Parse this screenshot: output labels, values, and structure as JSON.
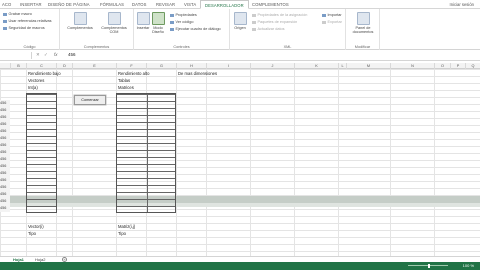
{
  "ribbon_tabs": [
    "ACO",
    "INSERTAR",
    "DISEÑO DE PÁGINA",
    "FÓRMULAS",
    "DATOS",
    "REVISAR",
    "VISTA",
    "DESARROLLADOR",
    "COMPLEMENTOS"
  ],
  "active_tab": "DESARROLLADOR",
  "user": "Iniciar sesión",
  "groups": {
    "code": {
      "label": "Código",
      "items": [
        "Grabar macro",
        "Usar referencias relativas",
        "Seguridad de macros"
      ]
    },
    "addins": {
      "label": "Complementos",
      "items": [
        "Complementos",
        "Complementos COM"
      ]
    },
    "controls": {
      "label": "Controles",
      "insert": "Insertar",
      "design": "Modo Diseño",
      "items": [
        "Propiedades",
        "Ver código",
        "Ejecutar cuadro de diálogo"
      ]
    },
    "xml": {
      "label": "XML",
      "source": "Origen",
      "items": [
        "Propiedades de la asignación",
        "Paquetes de expansión",
        "Actualizar datos"
      ],
      "items2": [
        "Importar",
        "Exportar"
      ]
    },
    "modify": {
      "label": "Modificar",
      "panel": "Panel de documentos"
    }
  },
  "formula_bar": {
    "fx": "fx",
    "value": "456"
  },
  "columns": [
    "B",
    "C",
    "D",
    "E",
    "F",
    "G",
    "H",
    "I",
    "J",
    "K",
    "L",
    "M",
    "N",
    "O",
    "P",
    "Q"
  ],
  "rows": [
    "456",
    "456",
    "456",
    "456",
    "456",
    "456",
    "456",
    "456",
    "456",
    "456",
    "456",
    "456",
    "456",
    "456",
    "456",
    "456"
  ],
  "cells": {
    "c1": "Rendimiento bajo",
    "c2": "Vectores",
    "c3": "Int(a)",
    "f1": "Rendimiento alto",
    "f2": "Tablas",
    "f3": "Matrices",
    "h1": "De mas dimensiones",
    "button": "Comenzar",
    "c_bottom1": "Vector(i)",
    "c_bottom2": "Tipo",
    "f_bottom1": "Matriz(i,j)",
    "f_bottom2": "Tipo"
  },
  "sheets": [
    "Hoja1",
    "Hoja2"
  ],
  "active_sheet": "Hoja1",
  "add_sheet": "+",
  "zoom": "100 %",
  "colors": {
    "accent": "#217346",
    "band": "#c5cdc7"
  }
}
